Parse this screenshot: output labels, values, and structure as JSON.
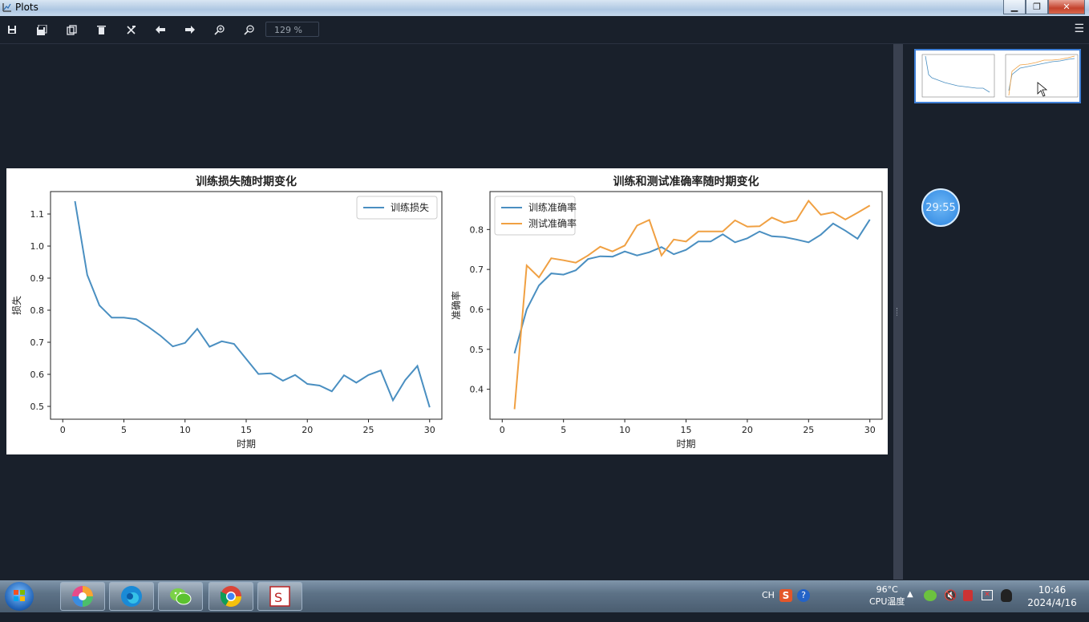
{
  "window": {
    "title": "Plots"
  },
  "toolbar": {
    "zoom": "129 %"
  },
  "timer": {
    "text": "29:55"
  },
  "taskbar": {
    "lang": "CH",
    "temp": "96°C",
    "temp_label": "CPU温度",
    "time": "10:46",
    "date": "2024/4/16"
  },
  "icons": [
    "save-icon",
    "save-all-icon",
    "copy-icon",
    "delete-icon",
    "delete-all-icon",
    "back-arrow-icon",
    "forward-arrow-icon",
    "zoom-in-icon",
    "zoom-out-icon",
    "menu-icon"
  ],
  "chart_data": [
    {
      "type": "line",
      "title": "训练损失随时期变化",
      "xlabel": "时期",
      "ylabel": "损失",
      "xlim": [
        -1,
        31
      ],
      "ylim": [
        0.46,
        1.17
      ],
      "xticks": [
        0,
        5,
        10,
        15,
        20,
        25,
        30
      ],
      "yticks": [
        0.5,
        0.6,
        0.7,
        0.8,
        0.9,
        1.0,
        1.1
      ],
      "legend": "top-right",
      "x": [
        1,
        2,
        3,
        4,
        5,
        6,
        7,
        8,
        9,
        10,
        11,
        12,
        13,
        14,
        15,
        16,
        17,
        18,
        19,
        20,
        21,
        22,
        23,
        24,
        25,
        26,
        27,
        28,
        29,
        30
      ],
      "series": [
        {
          "name": "训练损失",
          "color": "#4a8fc1",
          "values": [
            1.14,
            0.91,
            0.815,
            0.777,
            0.777,
            0.772,
            0.748,
            0.72,
            0.687,
            0.698,
            0.742,
            0.686,
            0.703,
            0.695,
            0.648,
            0.601,
            0.603,
            0.58,
            0.598,
            0.57,
            0.565,
            0.547,
            0.597,
            0.574,
            0.598,
            0.612,
            0.519,
            0.582,
            0.626,
            0.497
          ]
        }
      ]
    },
    {
      "type": "line",
      "title": "训练和测试准确率随时期变化",
      "xlabel": "时期",
      "ylabel": "准确率",
      "xlim": [
        -1,
        31
      ],
      "ylim": [
        0.325,
        0.895
      ],
      "xticks": [
        0,
        5,
        10,
        15,
        20,
        25,
        30
      ],
      "yticks": [
        0.4,
        0.5,
        0.6,
        0.7,
        0.8
      ],
      "legend": "top-left",
      "x": [
        1,
        2,
        3,
        4,
        5,
        6,
        7,
        8,
        9,
        10,
        11,
        12,
        13,
        14,
        15,
        16,
        17,
        18,
        19,
        20,
        21,
        22,
        23,
        24,
        25,
        26,
        27,
        28,
        29,
        30
      ],
      "series": [
        {
          "name": "训练准确率",
          "color": "#4a8fc1",
          "values": [
            0.49,
            0.6,
            0.66,
            0.69,
            0.687,
            0.698,
            0.726,
            0.733,
            0.732,
            0.745,
            0.735,
            0.743,
            0.756,
            0.738,
            0.749,
            0.77,
            0.77,
            0.788,
            0.768,
            0.778,
            0.795,
            0.783,
            0.781,
            0.775,
            0.768,
            0.787,
            0.815,
            0.797,
            0.777,
            0.825
          ]
        },
        {
          "name": "测试准确率",
          "color": "#f0a042",
          "values": [
            0.35,
            0.71,
            0.68,
            0.728,
            0.723,
            0.717,
            0.735,
            0.757,
            0.745,
            0.76,
            0.81,
            0.824,
            0.735,
            0.775,
            0.77,
            0.795,
            0.795,
            0.795,
            0.823,
            0.807,
            0.808,
            0.83,
            0.817,
            0.823,
            0.872,
            0.837,
            0.843,
            0.825,
            0.842,
            0.86
          ]
        }
      ]
    }
  ]
}
